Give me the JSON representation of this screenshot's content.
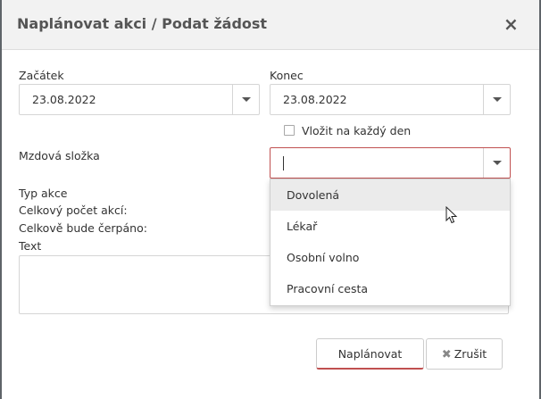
{
  "dialog": {
    "title": "Naplánovat akci / Podat žádost"
  },
  "form": {
    "start_label": "Začátek",
    "start_value": "23.08.2022",
    "end_label": "Konec",
    "end_value": "23.08.2022",
    "every_day_label": "Vložit na každý den",
    "every_day_checked": false,
    "wage_component_label": "Mzdová složka",
    "wage_component_value": "",
    "action_type_label": "Typ akce",
    "total_count_label": "Celkový počet akcí:",
    "total_drawn_label": "Celkově bude čerpáno:",
    "text_label": "Text",
    "text_value": ""
  },
  "dropdown": {
    "options": [
      "Dovolená",
      "Lékař",
      "Osobní volno",
      "Pracovní cesta"
    ],
    "hovered_index": 0
  },
  "buttons": {
    "schedule_label": "Naplánovat",
    "cancel_label": "Zrušit"
  },
  "colors": {
    "accent": "#c05050",
    "header_bg": "#f2f2f2",
    "hover_bg": "#ebebeb"
  }
}
